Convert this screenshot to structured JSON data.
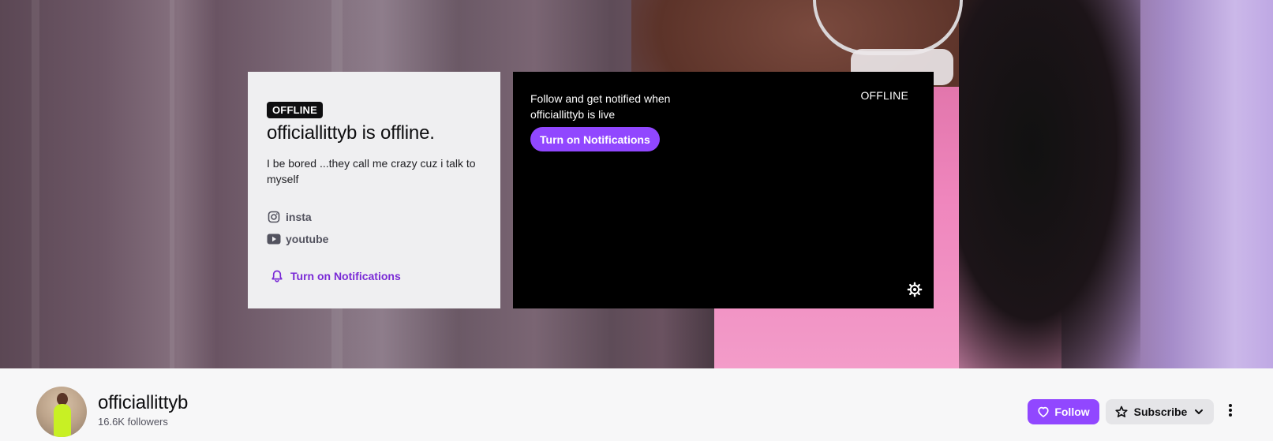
{
  "info_card": {
    "badge": "OFFLINE",
    "title": "officiallittyb is offline.",
    "description": "I be bored ...they call me crazy cuz i talk to myself",
    "social_links": [
      {
        "label": "insta",
        "icon": "instagram-icon"
      },
      {
        "label": "youtube",
        "icon": "youtube-icon"
      }
    ],
    "notifications_label": "Turn on Notifications"
  },
  "player": {
    "message": "Follow and get notified when officiallittyb is live",
    "button_label": "Turn on Notifications",
    "status": "OFFLINE",
    "settings_icon": "gear-icon"
  },
  "channel": {
    "name": "officiallittyb",
    "followers": "16.6K followers",
    "follow_label": "Follow",
    "subscribe_label": "Subscribe",
    "more_icon": "more-vertical-icon"
  },
  "colors": {
    "accent": "#9147ff",
    "link": "#7a2ad6",
    "card_bg": "#efeff1",
    "player_bg": "#000000"
  }
}
